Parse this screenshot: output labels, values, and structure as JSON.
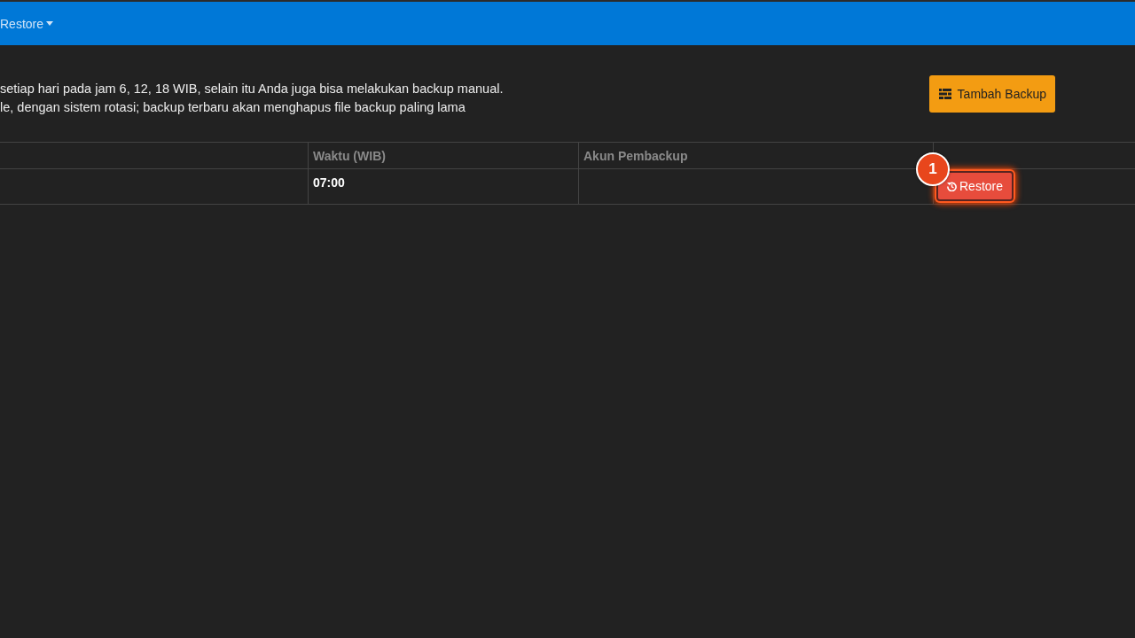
{
  "navbar": {
    "menu": {
      "label": "Restore"
    }
  },
  "info": {
    "lines": [
      "setiap hari pada jam 6, 12, 18 WIB, selain itu Anda juga bisa melakukan backup manual.",
      "le, dengan sistem rotasi; backup terbaru akan menghapus file backup paling lama"
    ]
  },
  "add_button": {
    "label": "Tambah Backup"
  },
  "table": {
    "columns": [
      "Waktu (WIB)",
      "Akun Pembackup"
    ],
    "rows": [
      {
        "time": "07:00",
        "button": {
          "label": "Restore",
          "highlighted": true
        },
        "annotation": "1"
      }
    ]
  }
}
